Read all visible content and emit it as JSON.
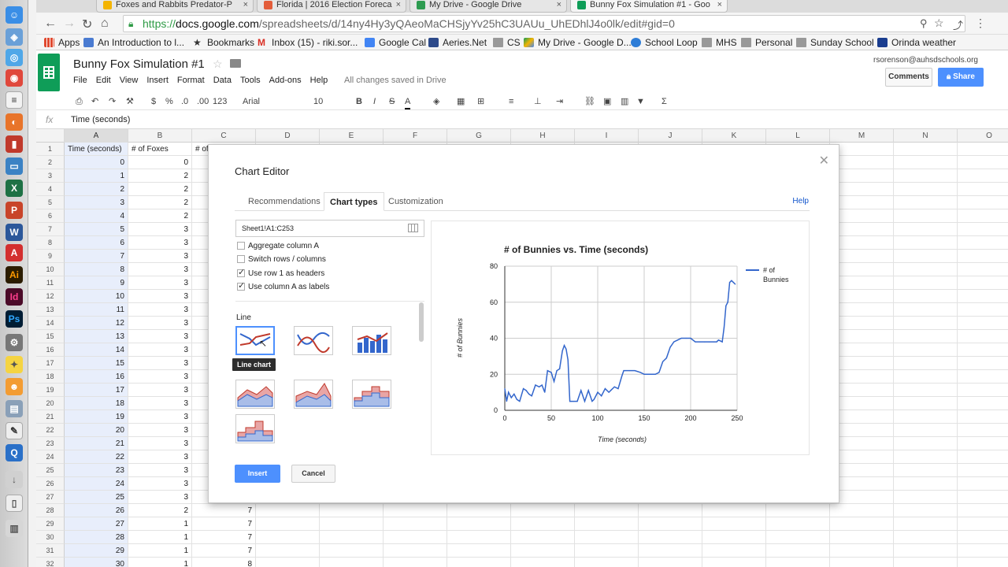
{
  "browser": {
    "tabs": [
      {
        "label": "Foxes and Rabbits Predator-P",
        "color": "#f4b400"
      },
      {
        "label": "Florida | 2016 Election Foreca",
        "color": "#e35d3a"
      },
      {
        "label": "My Drive - Google Drive",
        "color": "#2d9b50"
      },
      {
        "label": "Bunny Fox Simulation #1 - Goo",
        "color": "#0f9d58"
      }
    ],
    "url_scheme": "https://",
    "url_host": "docs.google.com",
    "url_path": "/spreadsheets/d/14ny4Hy3yQAeoMaCHSjyYv25hC3UAUu_UhEDhlJ4o0lk/edit#gid=0",
    "bookmarks": [
      {
        "label": "Apps",
        "color": "#e0492f"
      },
      {
        "label": "An Introduction to l...",
        "color": "#4a7bd1"
      },
      {
        "label": "Bookmarks",
        "color": "#333333"
      },
      {
        "label": "Inbox (15) - riki.sor...",
        "color": "#d93025"
      },
      {
        "label": "Google Cal",
        "color": "#4285f4"
      },
      {
        "label": "Aeries.Net",
        "color": "#2d4a8a"
      },
      {
        "label": "CS",
        "color": "#888888"
      },
      {
        "label": "My Drive - Google D...",
        "color": "#f4b400"
      },
      {
        "label": "School Loop",
        "color": "#2e7dd7"
      },
      {
        "label": "MHS",
        "color": "#888888"
      },
      {
        "label": "Personal",
        "color": "#888888"
      },
      {
        "label": "Sunday School",
        "color": "#888888"
      },
      {
        "label": "Orinda weather",
        "color": "#1a3d8f"
      }
    ]
  },
  "sheets": {
    "title": "Bunny Fox Simulation #1",
    "menu": [
      "File",
      "Edit",
      "View",
      "Insert",
      "Format",
      "Data",
      "Tools",
      "Add-ons",
      "Help"
    ],
    "saved_status": "All changes saved in Drive",
    "user_email": "rsorenson@auhsdschools.org",
    "comments_label": "Comments",
    "share_label": "Share",
    "toolbar": {
      "zoom": "123",
      "currency": "$",
      "percent": "%",
      "dec_less": ".0",
      "dec_more": ".00",
      "font": "Arial",
      "font_size": "10",
      "bold": "B",
      "italic": "I",
      "strike": "S",
      "text_color": "A",
      "sigma": "Σ"
    },
    "formula_bar": {
      "fx": "fx",
      "value": "Time (seconds)"
    },
    "columns": [
      "A",
      "B",
      "C",
      "D",
      "E",
      "F",
      "G",
      "H",
      "I",
      "J",
      "K",
      "L",
      "M",
      "N",
      "O"
    ],
    "header_row": [
      "Time (seconds)",
      "# of Foxes",
      "# of"
    ],
    "rows": [
      {
        "n": "1"
      },
      {
        "n": "2",
        "a": "0",
        "b": "0"
      },
      {
        "n": "3",
        "a": "1",
        "b": "2"
      },
      {
        "n": "4",
        "a": "2",
        "b": "2"
      },
      {
        "n": "5",
        "a": "3",
        "b": "2"
      },
      {
        "n": "6",
        "a": "4",
        "b": "2"
      },
      {
        "n": "7",
        "a": "5",
        "b": "3"
      },
      {
        "n": "8",
        "a": "6",
        "b": "3"
      },
      {
        "n": "9",
        "a": "7",
        "b": "3"
      },
      {
        "n": "10",
        "a": "8",
        "b": "3"
      },
      {
        "n": "11",
        "a": "9",
        "b": "3"
      },
      {
        "n": "12",
        "a": "10",
        "b": "3"
      },
      {
        "n": "13",
        "a": "11",
        "b": "3"
      },
      {
        "n": "14",
        "a": "12",
        "b": "3"
      },
      {
        "n": "15",
        "a": "13",
        "b": "3"
      },
      {
        "n": "16",
        "a": "14",
        "b": "3"
      },
      {
        "n": "17",
        "a": "15",
        "b": "3"
      },
      {
        "n": "18",
        "a": "16",
        "b": "3"
      },
      {
        "n": "19",
        "a": "17",
        "b": "3"
      },
      {
        "n": "20",
        "a": "18",
        "b": "3"
      },
      {
        "n": "21",
        "a": "19",
        "b": "3"
      },
      {
        "n": "22",
        "a": "20",
        "b": "3"
      },
      {
        "n": "23",
        "a": "21",
        "b": "3"
      },
      {
        "n": "24",
        "a": "22",
        "b": "3"
      },
      {
        "n": "25",
        "a": "23",
        "b": "3"
      },
      {
        "n": "26",
        "a": "24",
        "b": "3"
      },
      {
        "n": "27",
        "a": "25",
        "b": "3"
      },
      {
        "n": "28",
        "a": "26",
        "b": "2",
        "c": "7"
      },
      {
        "n": "29",
        "a": "27",
        "b": "1",
        "c": "7"
      },
      {
        "n": "30",
        "a": "28",
        "b": "1",
        "c": "7"
      },
      {
        "n": "31",
        "a": "29",
        "b": "1",
        "c": "7"
      },
      {
        "n": "32",
        "a": "30",
        "b": "1",
        "c": "8"
      }
    ]
  },
  "chart_editor": {
    "title": "Chart Editor",
    "tabs": [
      "Recommendations",
      "Chart types",
      "Customization"
    ],
    "active_tab": "Chart types",
    "help": "Help",
    "range": "Sheet1!A1:C253",
    "options": [
      {
        "label": "Aggregate column A",
        "checked": false
      },
      {
        "label": "Switch rows / columns",
        "checked": false
      },
      {
        "label": "Use row 1 as headers",
        "checked": true
      },
      {
        "label": "Use column A as labels",
        "checked": true
      }
    ],
    "section_label": "Line",
    "tooltip": "Line chart",
    "insert_label": "Insert",
    "cancel_label": "Cancel",
    "accent": "#4d90fe"
  },
  "chart_data": {
    "type": "line",
    "title": "# of Bunnies vs. Time (seconds)",
    "xlabel": "Time (seconds)",
    "ylabel": "# of Bunnies",
    "xlim": [
      0,
      250
    ],
    "ylim": [
      0,
      80
    ],
    "xticks": [
      0,
      50,
      100,
      150,
      200,
      250
    ],
    "yticks": [
      0,
      20,
      40,
      60,
      80
    ],
    "grid": true,
    "legend_position": "right",
    "series": [
      {
        "name": "# of Bunnies",
        "color": "#3366cc",
        "x": [
          0,
          2,
          4,
          7,
          10,
          13,
          16,
          20,
          23,
          26,
          29,
          33,
          37,
          40,
          43,
          46,
          50,
          53,
          56,
          59,
          62,
          64,
          66,
          68,
          70,
          72,
          74,
          78,
          82,
          86,
          90,
          94,
          96,
          100,
          104,
          108,
          112,
          114,
          118,
          122,
          126,
          128,
          130,
          134,
          140,
          146,
          150,
          154,
          158,
          162,
          166,
          170,
          174,
          178,
          182,
          186,
          190,
          195,
          200,
          205,
          210,
          215,
          220,
          225,
          228,
          230,
          234,
          236,
          238,
          240,
          242,
          244,
          246,
          248
        ],
        "y": [
          12,
          5,
          10,
          7,
          9,
          6,
          5,
          12,
          11,
          9,
          8,
          14,
          13,
          14,
          10,
          22,
          21,
          16,
          22,
          23,
          33,
          36,
          34,
          28,
          5,
          5,
          5,
          5,
          11,
          5,
          11,
          5,
          6,
          10,
          8,
          12,
          10,
          11,
          13,
          12,
          19,
          22,
          22,
          22,
          22,
          21,
          20,
          20,
          20,
          20,
          21,
          27,
          29,
          35,
          38,
          39,
          40,
          40,
          40,
          38,
          38,
          38,
          38,
          38,
          38,
          39,
          38,
          46,
          58,
          60,
          71,
          72,
          71,
          70
        ]
      }
    ]
  }
}
